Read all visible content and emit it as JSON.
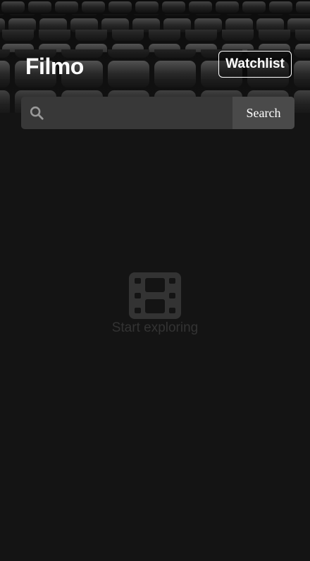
{
  "app": {
    "brand": "Filmo",
    "watchlist_label": "Watchlist"
  },
  "search": {
    "value": "",
    "placeholder": "",
    "button_label": "Search",
    "icon": "search-icon"
  },
  "empty_state": {
    "icon": "film-icon",
    "caption": "Start exploring"
  },
  "colors": {
    "background": "#141414",
    "search_field": "#383838",
    "search_button": "#4a4a4a",
    "muted": "#333333"
  }
}
